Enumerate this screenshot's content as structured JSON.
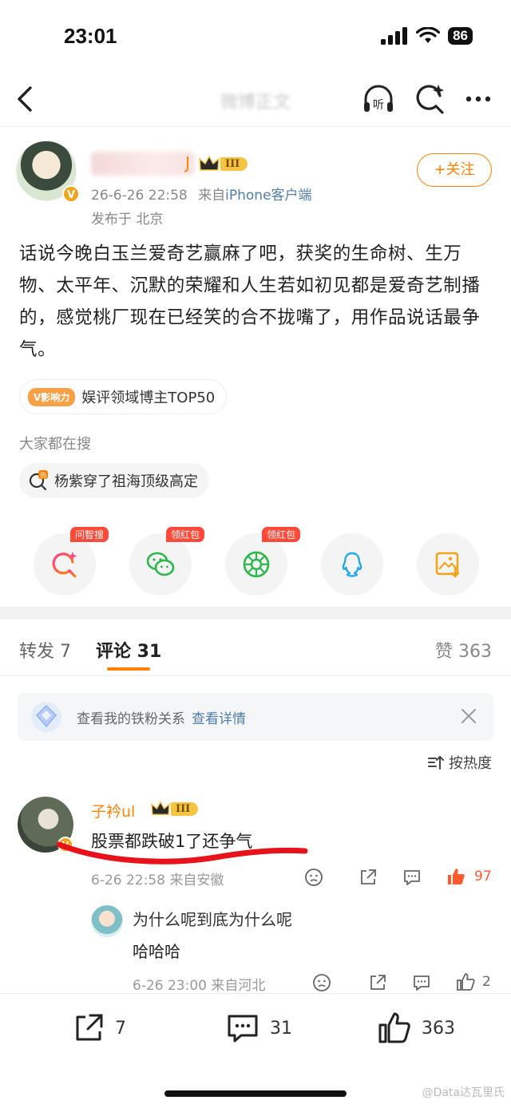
{
  "status_bar": {
    "time": "23:01",
    "battery": "86"
  },
  "nav": {
    "title": "微博正文"
  },
  "author": {
    "name_suffix": "J",
    "level": "III",
    "time": "26-6-26 22:58",
    "source_prefix": "来自",
    "source": "iPhone客户端",
    "location": "发布于 北京",
    "follow_label": "+关注"
  },
  "post": {
    "text": "话说今晚白玉兰爱奇艺赢麻了吧，获奖的生命树、生万物、太平年、沉默的荣耀和人生若如初见都是爱奇艺制播的，感觉桃厂现在已经笑的合不拢嘴了，用作品说话最争气。"
  },
  "influence": {
    "tag": "V影响力",
    "label": "娱评领域博主TOP50"
  },
  "search": {
    "hint": "大家都在搜",
    "hot_tag": "热",
    "topic": "杨紫穿了祖海顶级高定"
  },
  "share": [
    {
      "name": "wenzhisou",
      "icon": "search-ai-icon",
      "tag": "问智搜"
    },
    {
      "name": "wechat",
      "icon": "wechat-icon",
      "tag": "领红包"
    },
    {
      "name": "moments",
      "icon": "moments-icon",
      "tag": "领红包"
    },
    {
      "name": "qq",
      "icon": "qq-icon",
      "tag": ""
    },
    {
      "name": "save-image",
      "icon": "save-image-icon",
      "tag": ""
    }
  ],
  "tabs": {
    "repost": "转发 7",
    "comment": "评论 31",
    "likes": "赞 363"
  },
  "fan_banner": {
    "text": "查看我的铁粉关系",
    "link": "查看详情"
  },
  "sort": {
    "label": "按热度"
  },
  "comment": {
    "user": "子衿ul",
    "level": "III",
    "text": "股票都跌破1了还争气",
    "meta": "6-26 22:58 来自安徽",
    "like_count": "97",
    "reply": {
      "question": "为什么呢到底为什么呢",
      "answer": "哈哈哈",
      "meta": "6-26 23:00 来自河北",
      "like_count": "2"
    }
  },
  "bottom_bar": {
    "repost_count": "7",
    "comment_count": "31",
    "like_count": "363"
  },
  "watermark": "@Data达瓦里氏",
  "colors": {
    "accent": "#ff8200",
    "link": "#507daf",
    "like": "#ff5a2e",
    "tag_red": "#ff4a3a"
  }
}
